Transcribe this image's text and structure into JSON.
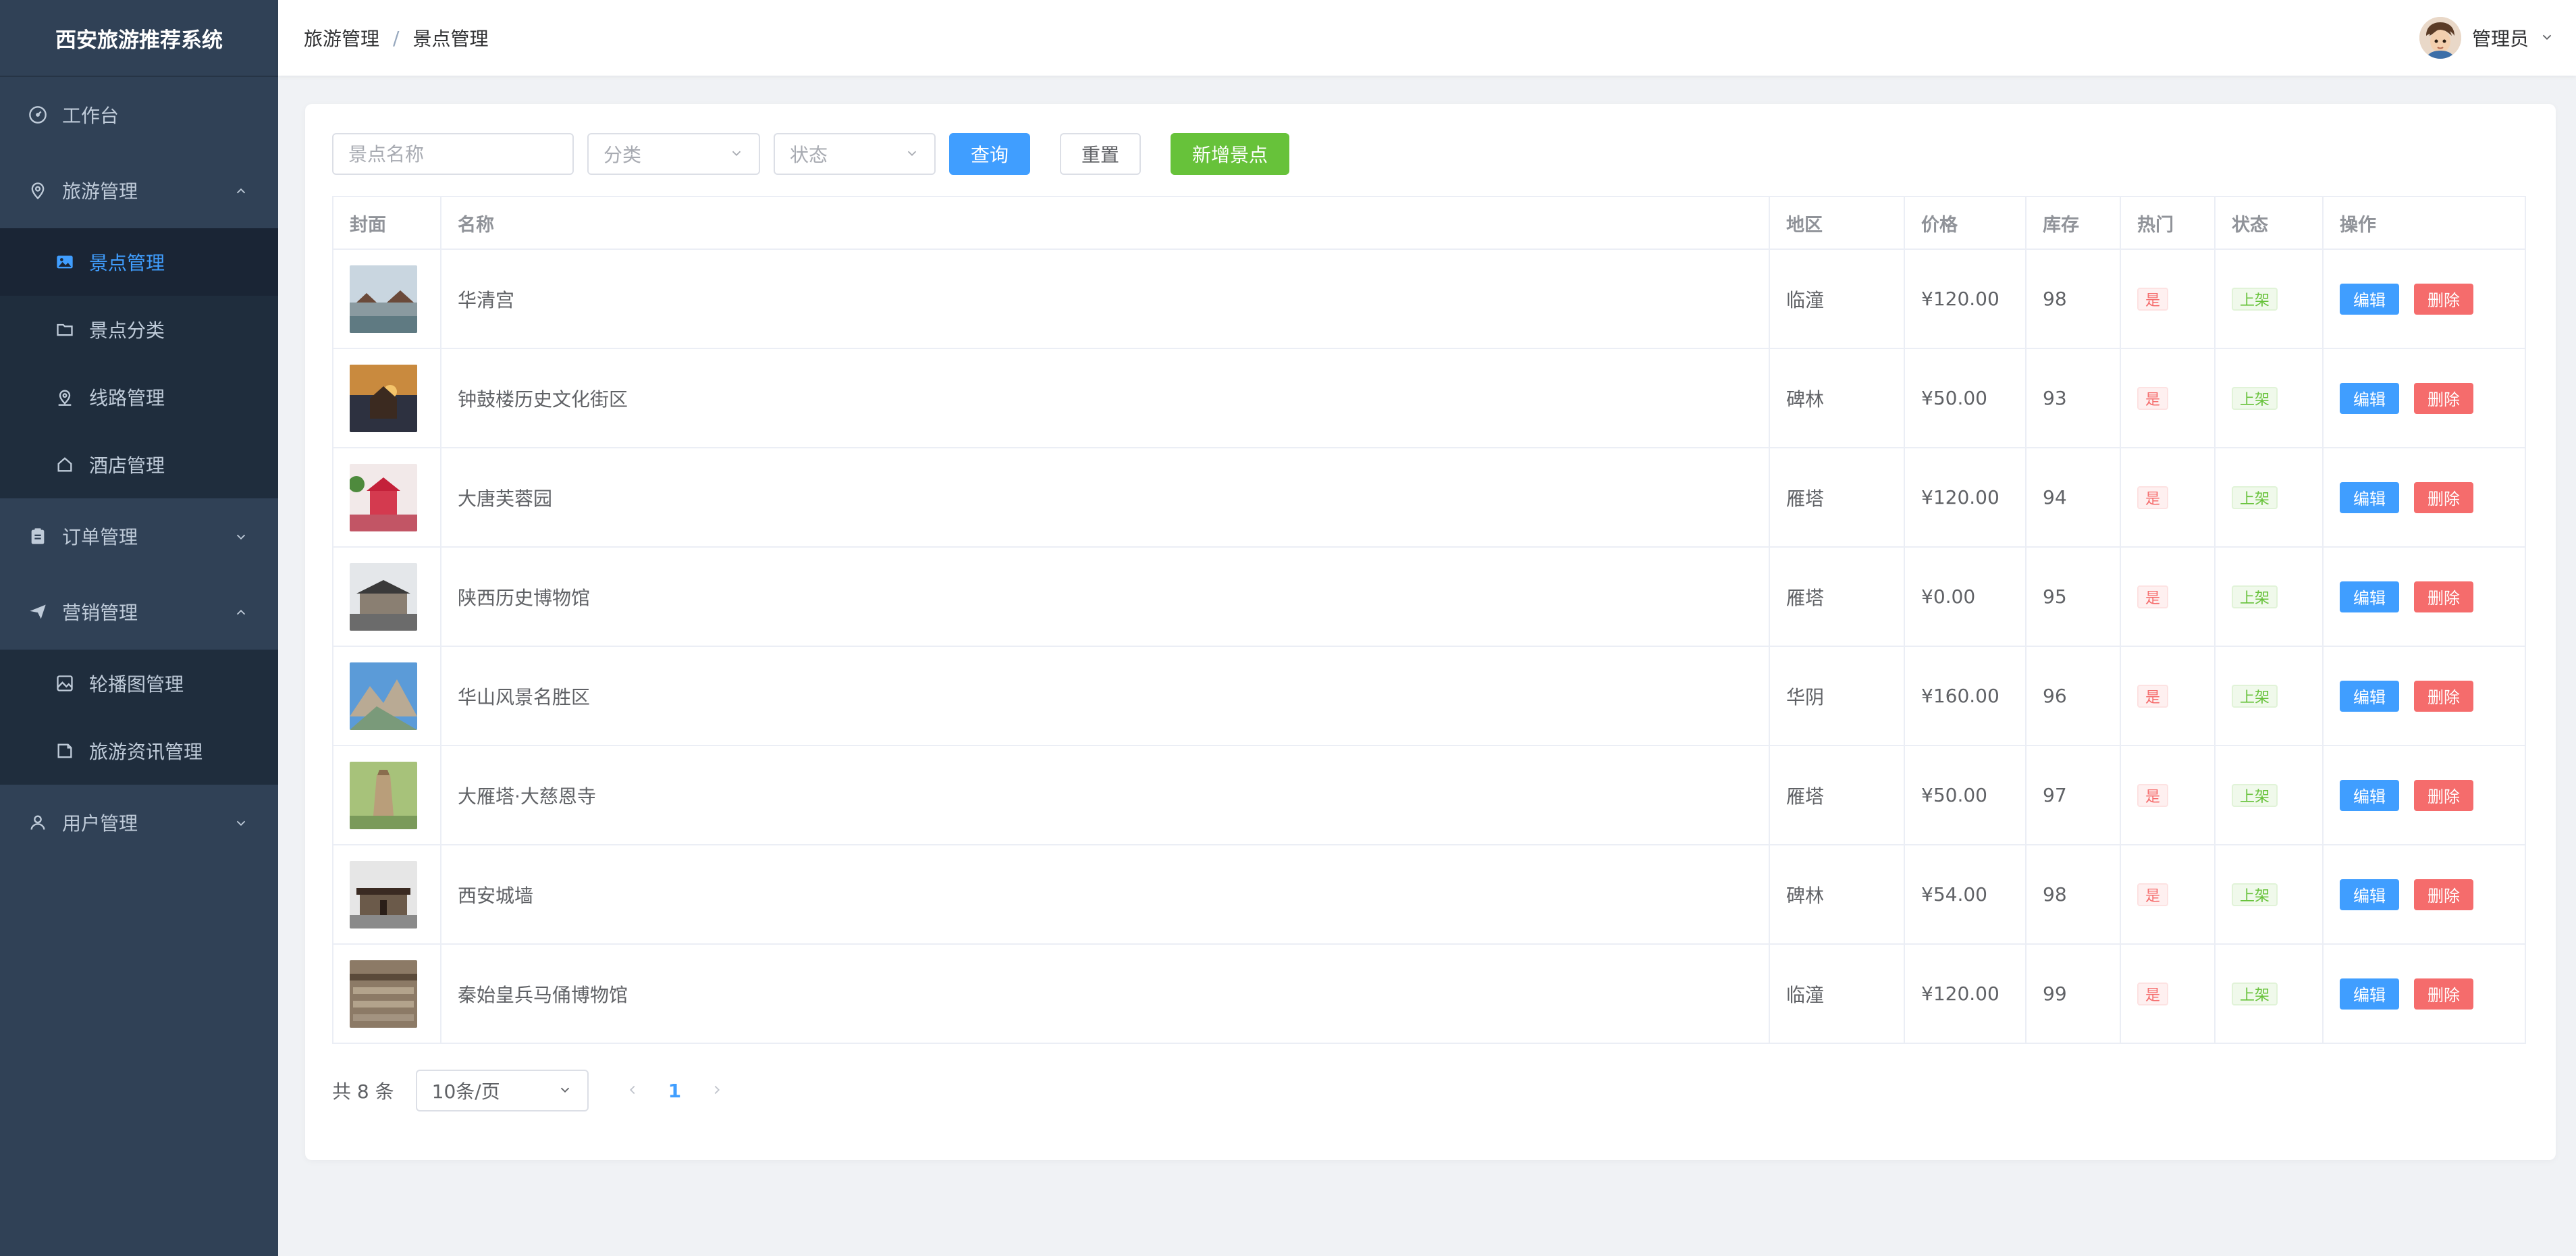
{
  "app": {
    "title": "西安旅游推荐系统"
  },
  "sidebar": {
    "items": [
      {
        "label": "工作台",
        "icon": "dashboard-icon"
      },
      {
        "label": "旅游管理",
        "icon": "location-icon",
        "expanded": true,
        "children": [
          {
            "label": "景点管理",
            "icon": "picture-icon",
            "active": true
          },
          {
            "label": "景点分类",
            "icon": "folder-icon"
          },
          {
            "label": "线路管理",
            "icon": "route-icon"
          },
          {
            "label": "酒店管理",
            "icon": "house-icon"
          }
        ]
      },
      {
        "label": "订单管理",
        "icon": "clipboard-icon",
        "expanded": false
      },
      {
        "label": "营销管理",
        "icon": "send-icon",
        "expanded": true,
        "children": [
          {
            "label": "轮播图管理",
            "icon": "image-icon"
          },
          {
            "label": "旅游资讯管理",
            "icon": "news-icon"
          }
        ]
      },
      {
        "label": "用户管理",
        "icon": "user-icon",
        "expanded": false
      }
    ]
  },
  "header": {
    "breadcrumb": [
      "旅游管理",
      "景点管理"
    ],
    "breadcrumb_separator": "/",
    "user": "管理员"
  },
  "filters": {
    "name_placeholder": "景点名称",
    "category_placeholder": "分类",
    "status_placeholder": "状态",
    "search_label": "查询",
    "reset_label": "重置",
    "add_label": "新增景点"
  },
  "table": {
    "columns": [
      "封面",
      "名称",
      "地区",
      "价格",
      "库存",
      "热门",
      "状态",
      "操作"
    ],
    "rows": [
      {
        "name": "华清宫",
        "region": "临潼",
        "price": "¥120.00",
        "stock": "98",
        "hot": "是",
        "status": "上架",
        "edit": "编辑",
        "delete": "删除"
      },
      {
        "name": "钟鼓楼历史文化街区",
        "region": "碑林",
        "price": "¥50.00",
        "stock": "93",
        "hot": "是",
        "status": "上架",
        "edit": "编辑",
        "delete": "删除"
      },
      {
        "name": "大唐芙蓉园",
        "region": "雁塔",
        "price": "¥120.00",
        "stock": "94",
        "hot": "是",
        "status": "上架",
        "edit": "编辑",
        "delete": "删除"
      },
      {
        "name": "陕西历史博物馆",
        "region": "雁塔",
        "price": "¥0.00",
        "stock": "95",
        "hot": "是",
        "status": "上架",
        "edit": "编辑",
        "delete": "删除"
      },
      {
        "name": "华山风景名胜区",
        "region": "华阴",
        "price": "¥160.00",
        "stock": "96",
        "hot": "是",
        "status": "上架",
        "edit": "编辑",
        "delete": "删除"
      },
      {
        "name": "大雁塔·大慈恩寺",
        "region": "雁塔",
        "price": "¥50.00",
        "stock": "97",
        "hot": "是",
        "status": "上架",
        "edit": "编辑",
        "delete": "删除"
      },
      {
        "name": "西安城墙",
        "region": "碑林",
        "price": "¥54.00",
        "stock": "98",
        "hot": "是",
        "status": "上架",
        "edit": "编辑",
        "delete": "删除"
      },
      {
        "name": "秦始皇兵马俑博物馆",
        "region": "临潼",
        "price": "¥120.00",
        "stock": "99",
        "hot": "是",
        "status": "上架",
        "edit": "编辑",
        "delete": "删除"
      }
    ]
  },
  "pagination": {
    "total": "共 8 条",
    "page_size": "10条/页",
    "current_page": "1"
  },
  "colors": {
    "sidebar_bg": "#304156",
    "accent": "#409eff",
    "success": "#67c23a",
    "danger": "#f56c6c"
  }
}
